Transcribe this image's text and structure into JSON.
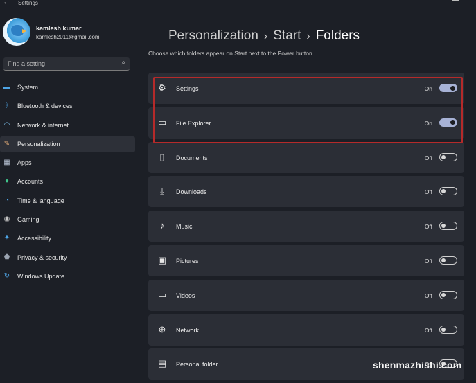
{
  "window": {
    "title": "Settings"
  },
  "user": {
    "name": "kamlesh kumar",
    "email": "kamlesh2011@gmail.com"
  },
  "search": {
    "placeholder": "Find a setting"
  },
  "sidebar": {
    "items": [
      {
        "label": "System",
        "icon": "monitor-icon",
        "color": "#4ea5e6"
      },
      {
        "label": "Bluetooth & devices",
        "icon": "bluetooth-icon",
        "color": "#4ea5e6"
      },
      {
        "label": "Network & internet",
        "icon": "wifi-icon",
        "color": "#7fc3f0"
      },
      {
        "label": "Personalization",
        "icon": "brush-icon",
        "color": "#e8b07a",
        "active": true
      },
      {
        "label": "Apps",
        "icon": "apps-icon",
        "color": "#b8c3d4"
      },
      {
        "label": "Accounts",
        "icon": "person-icon",
        "color": "#3fc58b"
      },
      {
        "label": "Time & language",
        "icon": "globe-clock-icon",
        "color": "#4ea5e6"
      },
      {
        "label": "Gaming",
        "icon": "gamepad-icon",
        "color": "#c7c7c7"
      },
      {
        "label": "Accessibility",
        "icon": "accessibility-icon",
        "color": "#4ea5e6"
      },
      {
        "label": "Privacy & security",
        "icon": "shield-icon",
        "color": "#9aa3b0"
      },
      {
        "label": "Windows Update",
        "icon": "update-icon",
        "color": "#4ea5e6"
      }
    ]
  },
  "breadcrumb": {
    "part1": "Personalization",
    "part2": "Start",
    "current": "Folders",
    "separator": "›"
  },
  "description": "Choose which folders appear on Start next to the Power button.",
  "folders": [
    {
      "label": "Settings",
      "state": "On",
      "on": true,
      "icon": "gear-icon"
    },
    {
      "label": "File Explorer",
      "state": "On",
      "on": true,
      "icon": "folder-icon"
    },
    {
      "label": "Documents",
      "state": "Off",
      "on": false,
      "icon": "document-icon"
    },
    {
      "label": "Downloads",
      "state": "Off",
      "on": false,
      "icon": "download-icon"
    },
    {
      "label": "Music",
      "state": "Off",
      "on": false,
      "icon": "music-icon"
    },
    {
      "label": "Pictures",
      "state": "Off",
      "on": false,
      "icon": "picture-icon"
    },
    {
      "label": "Videos",
      "state": "Off",
      "on": false,
      "icon": "video-icon"
    },
    {
      "label": "Network",
      "state": "Off",
      "on": false,
      "icon": "network-globe-icon"
    },
    {
      "label": "Personal folder",
      "state": "Off",
      "on": false,
      "icon": "personal-folder-icon"
    }
  ],
  "watermark": "shenmazhishi.com",
  "colors": {
    "background": "#1c1f26",
    "card": "#2b2e36",
    "accent": "#a7b2d6",
    "highlight": "#b52a2a"
  }
}
